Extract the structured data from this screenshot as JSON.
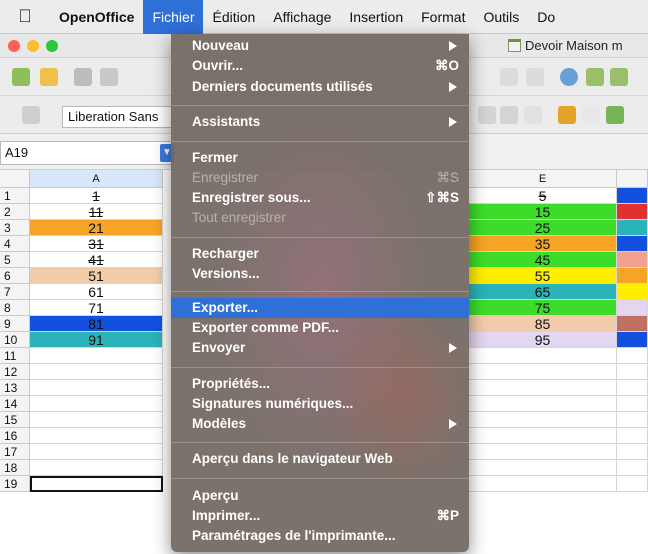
{
  "menubar": {
    "items": [
      {
        "label": "OpenOffice",
        "app": true
      },
      {
        "label": "Fichier",
        "active": true
      },
      {
        "label": "Édition"
      },
      {
        "label": "Affichage"
      },
      {
        "label": "Insertion"
      },
      {
        "label": "Format"
      },
      {
        "label": "Outils"
      },
      {
        "label": "Do"
      }
    ]
  },
  "window": {
    "title": "Devoir Maison m"
  },
  "toolbar": {
    "font_name": "Liberation Sans"
  },
  "namebox": {
    "value": "A19"
  },
  "grid": {
    "columns": [
      "A",
      "E"
    ],
    "rows": [
      "1",
      "2",
      "3",
      "4",
      "5",
      "6",
      "7",
      "8",
      "9",
      "10",
      "11",
      "12",
      "13",
      "14",
      "15",
      "16",
      "17",
      "18",
      "19"
    ],
    "col_a": [
      "1",
      "11",
      "21",
      "31",
      "41",
      "51",
      "61",
      "71",
      "81",
      "91"
    ],
    "col_e": [
      "5",
      "15",
      "25",
      "35",
      "45",
      "55",
      "65",
      "75",
      "85",
      "95"
    ],
    "col_a_strike": [
      true,
      true,
      false,
      true,
      true,
      false,
      false,
      false,
      false,
      false
    ],
    "col_e_strike": [
      true,
      false,
      false,
      false,
      false,
      false,
      false,
      false,
      false,
      false
    ],
    "col_a_fill": [
      "#ffffff",
      "#ffffff",
      "#f5a425",
      "#ffffff",
      "#ffffff",
      "#f2ccaa",
      "#ffffff",
      "#ffffff",
      "#1450e0",
      "#2ab3b8"
    ],
    "col_e_fill": [
      "#ffffff",
      "#3ddc2a",
      "#3ddc2a",
      "#f5a425",
      "#3ddc2a",
      "#ffee00",
      "#2ab3b8",
      "#3ddc2a",
      "#f2ccaa",
      "#e3d6f0"
    ]
  },
  "menu": {
    "items": [
      {
        "label": "Nouveau",
        "submenu": true
      },
      {
        "label": "Ouvrir...",
        "shortcut": "⌘O"
      },
      {
        "label": "Derniers documents utilisés",
        "submenu": true
      },
      {
        "label": "Assistants",
        "submenu": true
      },
      {
        "label": "Fermer"
      },
      {
        "label": "Enregistrer",
        "shortcut": "⌘S",
        "disabled": true
      },
      {
        "label": "Enregistrer sous...",
        "shortcut": "⇧⌘S"
      },
      {
        "label": "Tout enregistrer",
        "disabled": true
      },
      {
        "label": "Recharger"
      },
      {
        "label": "Versions..."
      },
      {
        "label": "Exporter...",
        "highlighted": true
      },
      {
        "label": "Exporter comme PDF..."
      },
      {
        "label": "Envoyer",
        "submenu": true
      },
      {
        "label": "Propriétés..."
      },
      {
        "label": "Signatures numériques..."
      },
      {
        "label": "Modèles",
        "submenu": true
      },
      {
        "label": "Aperçu dans le navigateur Web"
      },
      {
        "label": "Aperçu"
      },
      {
        "label": "Imprimer...",
        "shortcut": "⌘P"
      },
      {
        "label": "Paramétrages de l'imprimante..."
      }
    ]
  }
}
